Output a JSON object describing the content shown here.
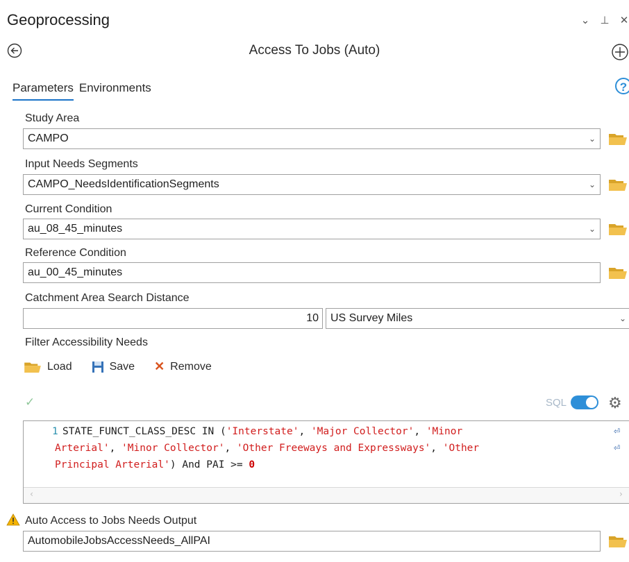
{
  "header": {
    "title": "Geoprocessing",
    "controls": [
      "⌄",
      "ᵖ",
      "✕"
    ]
  },
  "tool": {
    "title": "Access To Jobs (Auto)"
  },
  "tabs": [
    {
      "label": "Parameters",
      "active": true
    },
    {
      "label": "Environments",
      "active": false
    }
  ],
  "help_label": "?",
  "params": {
    "study_area": {
      "label": "Study Area",
      "value": "CAMPO"
    },
    "input_needs": {
      "label": "Input Needs Segments",
      "value": "CAMPO_NeedsIdentificationSegments"
    },
    "current_condition": {
      "label": "Current Condition",
      "value": "au_08_45_minutes"
    },
    "reference_condition": {
      "label": "Reference Condition",
      "value": "au_00_45_minutes"
    },
    "catchment": {
      "label": "Catchment Area Search Distance",
      "value": "10",
      "unit": "US Survey Miles"
    },
    "filter": {
      "label": "Filter Accessibility Needs"
    },
    "output": {
      "label": "Auto Access to Jobs Needs Output",
      "value": "AutomobileJobsAccessNeeds_AllPAI"
    }
  },
  "filter_toolbar": {
    "load": "Load",
    "save": "Save",
    "remove": "Remove",
    "sql_label": "SQL"
  },
  "sql_editor": {
    "line_number": "1",
    "line1_kw": "STATE_FUNCT_CLASS_DESC IN (",
    "line1_s1": "'Interstate'",
    "sep1": ", ",
    "line1_s2": "'Major Collector'",
    "sep2": ", ",
    "line1_s3": "'Minor",
    "line2_s3b": "Arterial'",
    "sep3": ", ",
    "line2_s4": "'Minor Collector'",
    "sep4": ", ",
    "line2_s5": "'Other Freeways and Expressways'",
    "sep5": ", ",
    "line2_s6": "'Other",
    "line3_s6b": "Principal Arterial'",
    "line3_kw": ") And PAI >= ",
    "line3_num": "0"
  },
  "colors": {
    "accent": "#2e8fd8",
    "folder": "#f2c14e",
    "string": "#d11d1d",
    "remove": "#d9531e",
    "warning": "#f5b400"
  }
}
